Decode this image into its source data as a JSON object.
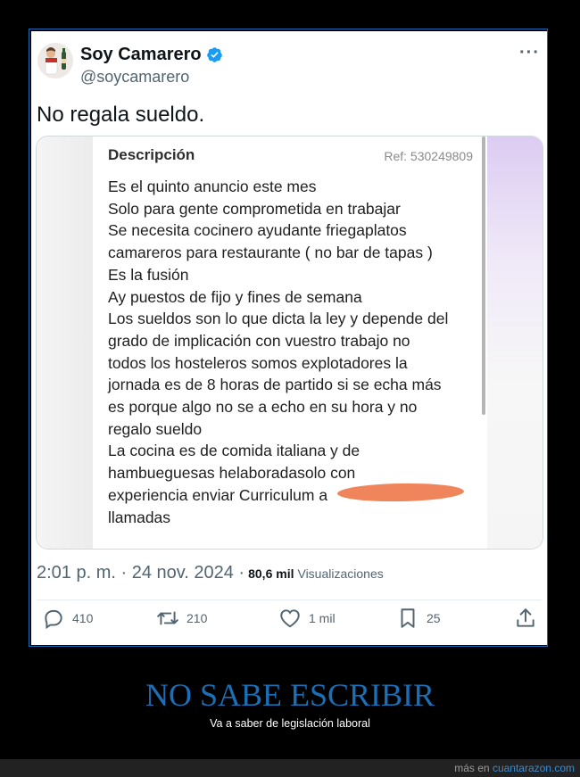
{
  "tweet": {
    "name": "Soy Camarero",
    "handle": "@soycamarero",
    "text": "No regala sueldo.",
    "time": "2:01 p. m. · 24 nov. 2024 ·",
    "views": "80,6 mil",
    "views_label": "Visualizaciones",
    "more_label": "···",
    "verified_color": "#1d9bf0",
    "counts": {
      "replies": "410",
      "retweets": "210",
      "likes": "1 mil",
      "bookmarks": "25"
    }
  },
  "card": {
    "title": "Descripción",
    "ref": "Ref: 530249809",
    "lines": [
      "Es el quinto anuncio este mes",
      "Solo para gente comprometida en trabajar",
      "Se necesita cocinero ayudante friegaplatos",
      "camareros para restaurante ( no bar de tapas )",
      "Es la fusión",
      "Ay puestos de fijo y fines de semana",
      "Los sueldos son lo que dicta la ley y depende del",
      "grado de implicación con vuestro trabajo no",
      "todos los hosteleros somos explotadores la",
      "jornada es de 8 horas de partido si se echa más",
      "es porque algo no se a echo en su hora y no",
      "regalo sueldo",
      "La cocina es de comida italiana y de",
      "hambueguesas helaboradasolo con",
      "experiencia enviar Curriculum a",
      "llamadas"
    ]
  },
  "caption": {
    "headline": "NO SABE ESCRIBIR",
    "subline": "Va a saber de legislación laboral",
    "headline_color": "#1b6fb6"
  },
  "footer": {
    "prefix": "más en",
    "site": "cuantarazon.com"
  }
}
